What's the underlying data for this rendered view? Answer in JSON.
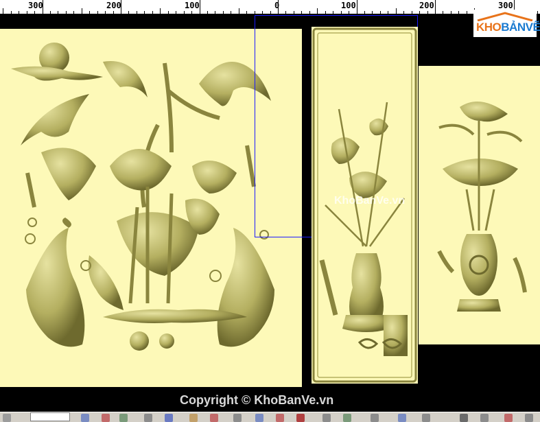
{
  "ruler": {
    "labels": [
      "300",
      "200",
      "100",
      "0",
      "100",
      "200",
      "300"
    ]
  },
  "logo": {
    "kho": "KHO",
    "banve": "BẢNVẼ"
  },
  "watermark": "KhoBanVe.vn",
  "copyright": "Copyright © KhoBanVe.vn",
  "panels": [
    {
      "name": "lotus-carp-relief",
      "subject": "lotus, birds and carp relief"
    },
    {
      "name": "vase-lotus-relief",
      "subject": "lotus vase relief"
    },
    {
      "name": "vase-lotus-relief-2",
      "subject": "lotus vase relief"
    }
  ],
  "colors": {
    "relief": "#c8c478",
    "relief_dark": "#7f7a3a",
    "background": "#fdf9b8",
    "canvas": "#000000"
  },
  "icons": [
    "select-arrow-icon",
    "tool-icon"
  ]
}
